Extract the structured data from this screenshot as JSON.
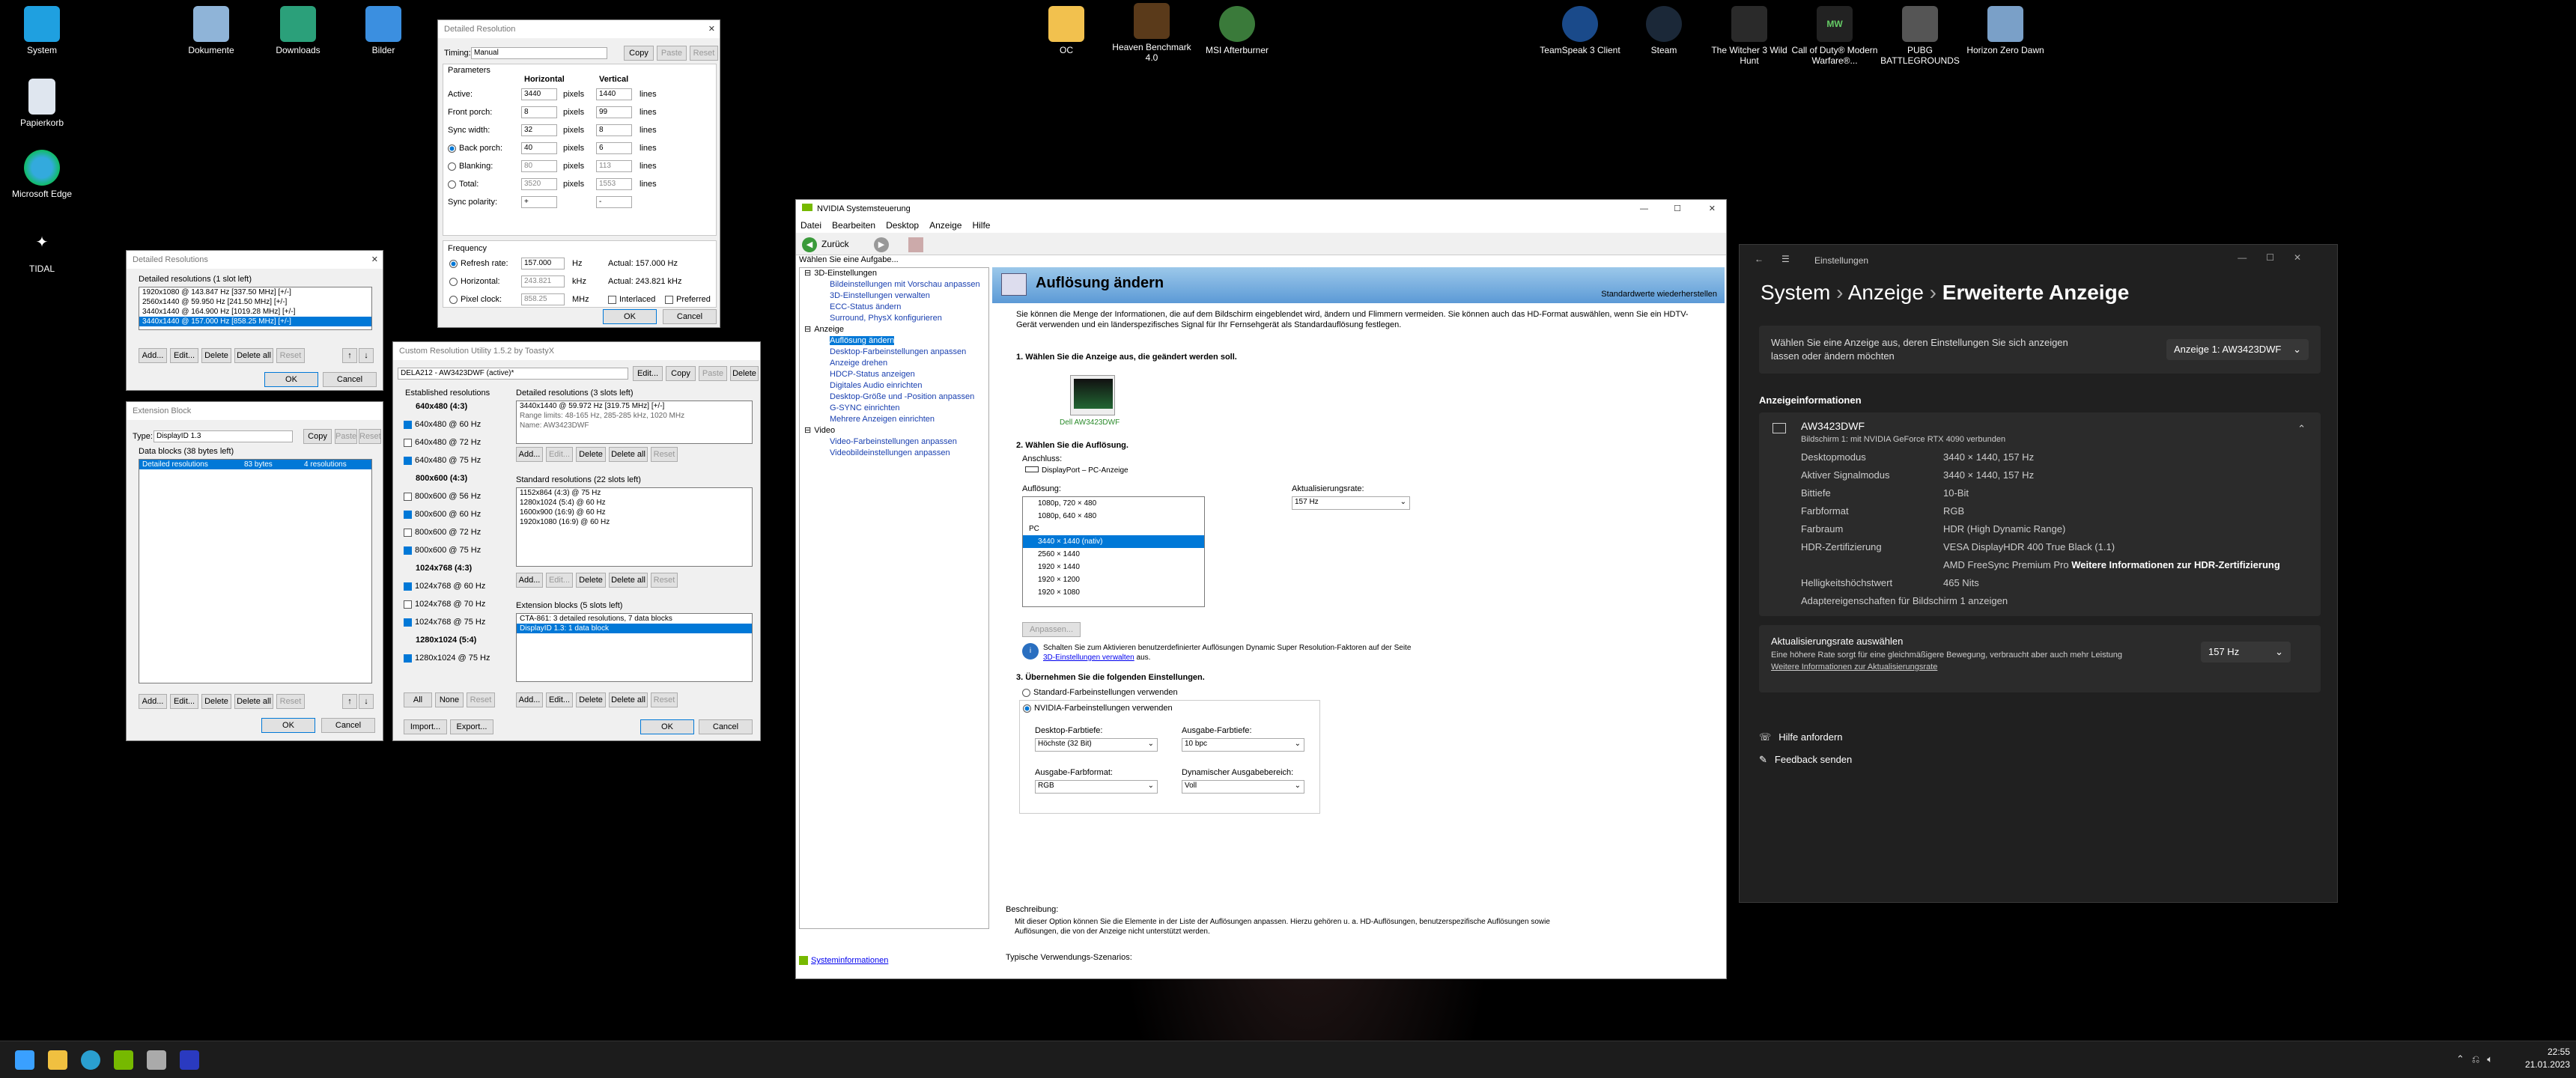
{
  "desktop": {
    "icons_left": [
      {
        "label": "System"
      },
      {
        "label": "Papierkorb"
      },
      {
        "label": "Microsoft Edge"
      },
      {
        "label": "TIDAL"
      }
    ],
    "icons_top": [
      {
        "label": "Dokumente"
      },
      {
        "label": "Downloads"
      },
      {
        "label": "Bilder"
      },
      {
        "label": "OC"
      },
      {
        "label": "Heaven Benchmark 4.0"
      },
      {
        "label": "MSI Afterburner"
      },
      {
        "label": "TeamSpeak 3 Client"
      },
      {
        "label": "Steam"
      },
      {
        "label": "The Witcher 3 Wild Hunt"
      },
      {
        "label": "Call of Duty® Modern Warfare®..."
      },
      {
        "label": "PUBG BATTLEGROUNDS"
      },
      {
        "label": "Horizon Zero Dawn"
      }
    ]
  },
  "detres": {
    "title": "Detailed Resolution",
    "timing_label": "Timing:",
    "timing_value": "Manual",
    "copy": "Copy",
    "paste": "Paste",
    "reset": "Reset",
    "params": "Parameters",
    "horizontal": "Horizontal",
    "vertical": "Vertical",
    "rows": [
      {
        "label": "Active:",
        "h": "3440",
        "hu": "pixels",
        "v": "1440",
        "vu": "lines"
      },
      {
        "label": "Front porch:",
        "h": "8",
        "hu": "pixels",
        "v": "99",
        "vu": "lines"
      },
      {
        "label": "Sync width:",
        "h": "32",
        "hu": "pixels",
        "v": "8",
        "vu": "lines"
      },
      {
        "label": "Back porch:",
        "h": "40",
        "hu": "pixels",
        "v": "6",
        "vu": "lines"
      },
      {
        "label": "Blanking:",
        "h": "80",
        "hu": "pixels",
        "v": "113",
        "vu": "lines"
      },
      {
        "label": "Total:",
        "h": "3520",
        "hu": "pixels",
        "v": "1553",
        "vu": "lines"
      },
      {
        "label": "Sync polarity:",
        "h": "+",
        "hu": "",
        "v": "-",
        "vu": ""
      }
    ],
    "frequency": "Frequency",
    "refresh_label": "Refresh rate:",
    "refresh": "157.000",
    "hz": "Hz",
    "actual_refresh": "Actual: 157.000 Hz",
    "horiz_label": "Horizontal:",
    "horiz": "243.821",
    "khz": "kHz",
    "actual_horiz": "Actual: 243.821 kHz",
    "pclk_label": "Pixel clock:",
    "pclk": "858.25",
    "mhz": "MHz",
    "interlaced": "Interlaced",
    "preferred": "Preferred",
    "ok": "OK",
    "cancel": "Cancel"
  },
  "detres2": {
    "title": "Detailed Resolutions",
    "header": "Detailed resolutions (1 slot left)",
    "items": [
      "1920x1080 @ 143.847 Hz [337.50 MHz] [+/-]",
      "2560x1440 @ 59.950 Hz [241.50 MHz] [+/-]",
      "3440x1440 @ 164.900 Hz [1019.28 MHz] [+/-]",
      "3440x1440 @ 157.000 Hz [858.25 MHz] [+/-]"
    ],
    "add": "Add...",
    "edit": "Edit...",
    "delete": "Delete",
    "delete_all": "Delete all",
    "reset": "Reset",
    "ok": "OK",
    "cancel": "Cancel"
  },
  "extblock": {
    "title": "Extension Block",
    "type_label": "Type:",
    "type_value": "DisplayID 1.3",
    "copy": "Copy",
    "paste": "Paste",
    "reset": "Reset",
    "header": "Data blocks (38 bytes left)",
    "row_name": "Detailed resolutions",
    "row_bytes": "83 bytes",
    "row_count": "4 resolutions",
    "add": "Add...",
    "edit": "Edit...",
    "delete": "Delete",
    "delete_all": "Delete all",
    "ok": "OK",
    "cancel": "Cancel"
  },
  "cru": {
    "title": "Custom Resolution Utility 1.5.2 by ToastyX",
    "monitor": "DELA212 - AW3423DWF (active)*",
    "edit": "Edit...",
    "copy": "Copy",
    "paste": "Paste",
    "delete": "Delete",
    "est_header": "Established resolutions",
    "est": [
      {
        "t": "640x480 (4:3)",
        "g": 1
      },
      {
        "t": "640x480 @ 60 Hz",
        "c": 1
      },
      {
        "t": "640x480 @ 72 Hz",
        "c": 0
      },
      {
        "t": "640x480 @ 75 Hz",
        "c": 1
      },
      {
        "t": "800x600 (4:3)",
        "g": 1
      },
      {
        "t": "800x600 @ 56 Hz",
        "c": 0
      },
      {
        "t": "800x600 @ 60 Hz",
        "c": 1
      },
      {
        "t": "800x600 @ 72 Hz",
        "c": 0
      },
      {
        "t": "800x600 @ 75 Hz",
        "c": 1
      },
      {
        "t": "1024x768 (4:3)",
        "g": 1
      },
      {
        "t": "1024x768 @ 60 Hz",
        "c": 1
      },
      {
        "t": "1024x768 @ 70 Hz",
        "c": 0
      },
      {
        "t": "1024x768 @ 75 Hz",
        "c": 1
      },
      {
        "t": "1280x1024 (5:4)",
        "g": 1
      },
      {
        "t": "1280x1024 @ 75 Hz",
        "c": 1
      }
    ],
    "all": "All",
    "none": "None",
    "reset": "Reset",
    "det_header": "Detailed resolutions (3 slots left)",
    "det_items": [
      "3440x1440 @ 59.972 Hz [319.75 MHz] [+/-]",
      "Range limits: 48-165 Hz, 285-285 kHz, 1020 MHz",
      "Name: AW3423DWF"
    ],
    "std_header": "Standard resolutions (22 slots left)",
    "std_items": [
      "1152x864 (4:3) @ 75 Hz",
      "1280x1024 (5:4) @ 60 Hz",
      "1600x900 (16:9) @ 60 Hz",
      "1920x1080 (16:9) @ 60 Hz"
    ],
    "ext_header": "Extension blocks (5 slots left)",
    "ext_items": [
      "CTA-861: 3 detailed resolutions, 7 data blocks",
      "DisplayID 1.3: 1 data block"
    ],
    "add": "Add...",
    "delete_all": "Delete all",
    "import": "Import...",
    "export": "Export...",
    "ok": "OK",
    "cancel": "Cancel"
  },
  "nvcp": {
    "title": "NVIDIA Systemsteuerung",
    "menu": [
      "Datei",
      "Bearbeiten",
      "Desktop",
      "Anzeige",
      "Hilfe"
    ],
    "back": "Zurück",
    "task_label": "Wählen Sie eine Aufgabe...",
    "tree": [
      {
        "t": "3D-Einstellungen",
        "l": 0
      },
      {
        "t": "Bildeinstellungen mit Vorschau anpassen",
        "l": 1
      },
      {
        "t": "3D-Einstellungen verwalten",
        "l": 1
      },
      {
        "t": "ECC-Status ändern",
        "l": 1
      },
      {
        "t": "Surround, PhysX konfigurieren",
        "l": 1
      },
      {
        "t": "Anzeige",
        "l": 0
      },
      {
        "t": "Auflösung ändern",
        "l": 1,
        "s": 1
      },
      {
        "t": "Desktop-Farbeinstellungen anpassen",
        "l": 1
      },
      {
        "t": "Anzeige drehen",
        "l": 1
      },
      {
        "t": "HDCP-Status anzeigen",
        "l": 1
      },
      {
        "t": "Digitales Audio einrichten",
        "l": 1
      },
      {
        "t": "Desktop-Größe und -Position anpassen",
        "l": 1
      },
      {
        "t": "G-SYNC einrichten",
        "l": 1
      },
      {
        "t": "Mehrere Anzeigen einrichten",
        "l": 1
      },
      {
        "t": "Video",
        "l": 0
      },
      {
        "t": "Video-Farbeinstellungen anpassen",
        "l": 1
      },
      {
        "t": "Videobildeinstellungen anpassen",
        "l": 1
      }
    ],
    "sysinfo": "Systeminformationen",
    "heading": "Auflösung ändern",
    "restore": "Standardwerte wiederherstellen",
    "intro": "Sie können die Menge der Informationen, die auf dem Bildschirm eingeblendet wird, ändern und Flimmern vermeiden. Sie können auch das HD-Format auswählen, wenn Sie ein HDTV-Gerät verwenden und ein länderspezifisches Signal für Ihr Fernsehgerät als Standardauflösung festlegen.",
    "s1": "1. Wählen Sie die Anzeige aus, die geändert werden soll.",
    "display_name": "Dell AW3423DWF",
    "s2": "2. Wählen Sie die Auflösung.",
    "conn_label": "Anschluss:",
    "conn": "DisplayPort – PC-Anzeige",
    "res_label": "Auflösung:",
    "res_items": [
      {
        "t": "1080p, 720 × 480"
      },
      {
        "t": "1080p, 640 × 480"
      },
      {
        "t": "PC",
        "h": 1
      },
      {
        "t": "3440 × 1440 (nativ)",
        "s": 1
      },
      {
        "t": "2560 × 1440"
      },
      {
        "t": "1920 × 1440"
      },
      {
        "t": "1920 × 1200"
      },
      {
        "t": "1920 × 1080"
      }
    ],
    "rate_label": "Aktualisierungsrate:",
    "rate": "157 Hz",
    "customize": "Anpassen...",
    "dsr_text": "Schalten Sie zum Aktivieren benutzerdefinierter Auflösungen Dynamic Super Resolution-Faktoren auf der Seite",
    "dsr_link": "3D-Einstellungen verwalten",
    "dsr_end": "aus.",
    "s3": "3. Übernehmen Sie die folgenden Einstellungen.",
    "opt_std": "Standard-Farbeinstellungen verwenden",
    "opt_nv": "NVIDIA-Farbeinstellungen verwenden",
    "desk_depth_label": "Desktop-Farbtiefe:",
    "desk_depth": "Höchste (32 Bit)",
    "out_depth_label": "Ausgabe-Farbtiefe:",
    "out_depth": "10 bpc",
    "out_fmt_label": "Ausgabe-Farbformat:",
    "out_fmt": "RGB",
    "range_label": "Dynamischer Ausgabebereich:",
    "range": "Voll",
    "desc_label": "Beschreibung:",
    "desc": "Mit dieser Option können Sie die Elemente in der Liste der Auflösungen anpassen. Hierzu gehören u. a. HD-Auflösungen, benutzerspezifische Auflösungen sowie Auflösungen, die von der Anzeige nicht unterstützt werden.",
    "typical": "Typische Verwendungs-Szenarios:"
  },
  "settings": {
    "title": "Einstellungen",
    "bc": [
      "System",
      "Anzeige",
      "Erweiterte Anzeige"
    ],
    "choose": "Wählen Sie eine Anzeige aus, deren Einstellungen Sie sich anzeigen lassen oder ändern möchten",
    "choose_val": "Anzeige 1: AW3423DWF",
    "info_header": "Anzeigeinformationen",
    "mon_name": "AW3423DWF",
    "mon_sub": "Bildschirm 1: mit NVIDIA GeForce RTX 4090 verbunden",
    "props": [
      {
        "k": "Desktopmodus",
        "v": "3440 × 1440, 157 Hz"
      },
      {
        "k": "Aktiver Signalmodus",
        "v": "3440 × 1440, 157 Hz"
      },
      {
        "k": "Bittiefe",
        "v": "10-Bit"
      },
      {
        "k": "Farbformat",
        "v": "RGB"
      },
      {
        "k": "Farbraum",
        "v": "HDR (High Dynamic Range)"
      },
      {
        "k": "HDR-Zertifizierung",
        "v": "VESA DisplayHDR 400 True Black (1.1)"
      },
      {
        "k": "",
        "v": "AMD FreeSync Premium Pro",
        "link": "Weitere Informationen zur HDR-Zertifizierung"
      },
      {
        "k": "Helligkeitshöchstwert",
        "v": "465 Nits"
      }
    ],
    "adapter": "Adaptereigenschaften für Bildschirm 1 anzeigen",
    "refresh_title": "Aktualisierungsrate auswählen",
    "refresh_desc": "Eine höhere Rate sorgt für eine gleichmäßigere Bewegung, verbraucht aber auch mehr Leistung",
    "refresh_link": "Weitere Informationen zur Aktualisierungsrate",
    "refresh_val": "157 Hz",
    "help": "Hilfe anfordern",
    "feedback": "Feedback senden"
  },
  "taskbar": {
    "time": "22:55",
    "date": "21.01.2023"
  }
}
